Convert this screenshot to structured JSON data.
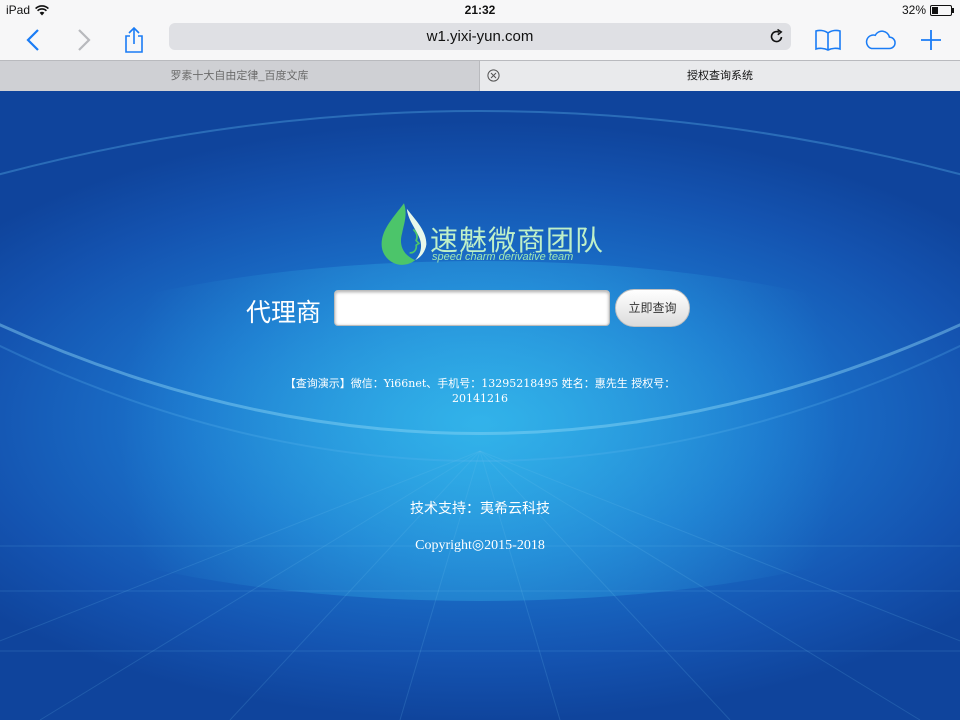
{
  "status_bar": {
    "device": "iPad",
    "time": "21:32",
    "battery_text": "32%",
    "battery_level": 0.32
  },
  "browser": {
    "url": "w1.yixi-yun.com",
    "tabs": [
      {
        "title": "罗素十大自由定律_百度文库",
        "active": false
      },
      {
        "title": "授权查询系统",
        "active": true
      }
    ]
  },
  "page": {
    "logo": {
      "title": "速魅微商团队",
      "subtitle": "speed charm derivative team"
    },
    "form": {
      "label": "代理商",
      "input_value": "",
      "button_label": "立即查询"
    },
    "demo_text": "【查询演示】微信：Yi66net、手机号：13295218495 姓名：惠先生 授权号：20141216",
    "support_text": "技术支持：夷希云科技",
    "copyright": "Copyright◎2015-2018"
  },
  "colors": {
    "page_blue": "#1453b0",
    "glow_blue": "#2a9fe0",
    "logo_green": "#4cc56a",
    "safari_blue": "#1a7cf5"
  }
}
